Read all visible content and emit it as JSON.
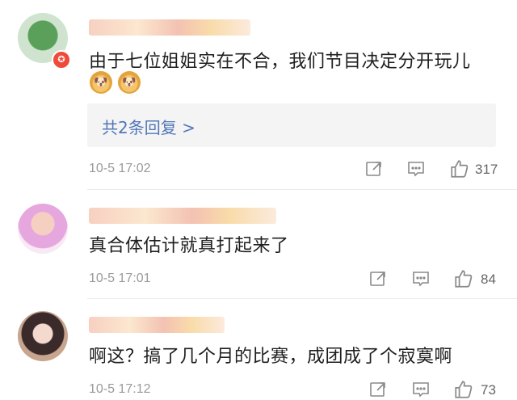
{
  "comments": [
    {
      "text": "由于七位姐姐实在不合，我们节目决定分开玩儿",
      "emojis": [
        "🐶",
        "🐶"
      ],
      "reply_link": "共2条回复 >",
      "time": "10-5 17:02",
      "likes": "317",
      "verified_badge": "✪"
    },
    {
      "text": "真合体估计就真打起来了",
      "time": "10-5 17:01",
      "likes": "84"
    },
    {
      "text": "啊这？搞了几个月的比赛，成团成了个寂寞啊",
      "time": "10-5 17:12",
      "likes": "73"
    }
  ],
  "icons": {
    "share": "share-icon",
    "comment": "comment-icon",
    "like": "like-icon"
  }
}
